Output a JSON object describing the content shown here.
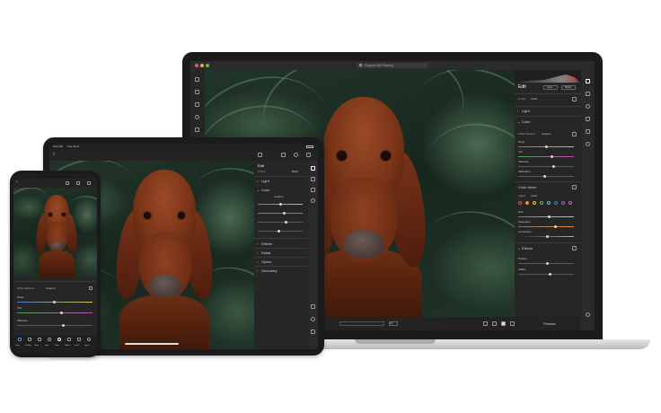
{
  "laptop": {
    "search_placeholder": "Search All Photos",
    "panel": {
      "title": "Edit",
      "auto_label": "Auto",
      "bw_label": "B&W",
      "profile_label": "Profile",
      "profile_value": "Color",
      "sections": [
        "Light",
        "Color",
        "Color Mixer",
        "Effects"
      ],
      "white_balance_label": "White Balance",
      "white_balance_value": "Custom",
      "sliders": [
        "Temp",
        "Tint",
        "Vibrance",
        "Saturation",
        "Hue",
        "Saturation",
        "Luminance",
        "Texture",
        "Clarity"
      ],
      "adjust_label": "Adjust",
      "adjust_value": "Color"
    },
    "bottom": {
      "zoom": "Fit",
      "presets_label": "Presets"
    }
  },
  "tablet": {
    "status_time": "9:41 AM",
    "status_date": "Tue Jan 9",
    "panel": {
      "title": "Edit",
      "auto_label": "B&W",
      "profile_label": "Profile",
      "sections": [
        "Light",
        "Color",
        "Effects",
        "Detail",
        "Optics",
        "Geometry"
      ],
      "white_balance_value": "Custom"
    }
  },
  "phone": {
    "panel": {
      "white_balance_label": "White Balance",
      "white_balance_value": "Custom",
      "sliders": [
        "Temp",
        "Tint",
        "Vibrance"
      ],
      "tools": [
        "Crop",
        "Profiles",
        "Auto",
        "Light",
        "Color",
        "Effects",
        "Detail",
        "Optics"
      ]
    }
  },
  "colors": {
    "device_frame": "#1b1b1b",
    "ui_panel": "#262626",
    "laptop_base": "#d9dadc",
    "accent": "#4a90e2"
  }
}
